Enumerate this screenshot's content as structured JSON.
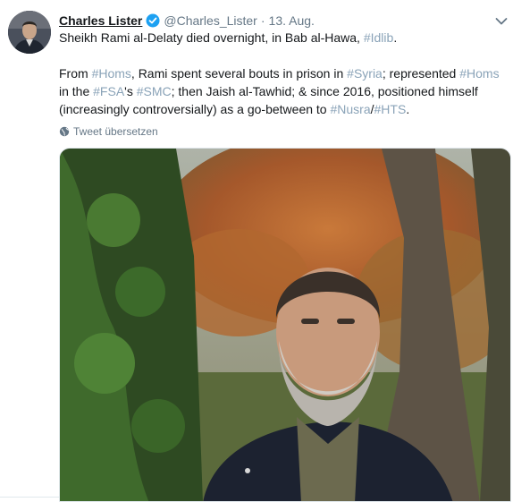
{
  "tweet": {
    "author_name": "Charles Lister",
    "handle": "@Charles_Lister",
    "separator": "·",
    "date": "13. Aug.",
    "paragraph1": [
      {
        "text": "Sheikh Rami al-Delaty died overnight, in Bab al-Hawa, ",
        "tag": false
      },
      {
        "text": "#Idlib",
        "tag": true
      },
      {
        "text": ".",
        "tag": false
      }
    ],
    "paragraph2": [
      {
        "text": "From ",
        "tag": false
      },
      {
        "text": "#Homs",
        "tag": true
      },
      {
        "text": ", Rami spent several bouts in prison in ",
        "tag": false
      },
      {
        "text": "#Syria",
        "tag": true
      },
      {
        "text": "; represented ",
        "tag": false
      },
      {
        "text": "#Homs",
        "tag": true
      },
      {
        "text": " in the ",
        "tag": false
      },
      {
        "text": "#FSA",
        "tag": true
      },
      {
        "text": "'s ",
        "tag": false
      },
      {
        "text": "#SMC",
        "tag": true
      },
      {
        "text": "; then Jaish al-Tawhid; & since 2016, positioned himself (increasingly controversially) as a go-between to ",
        "tag": false
      },
      {
        "text": "#Nusra",
        "tag": true
      },
      {
        "text": "/",
        "tag": false
      },
      {
        "text": "#HTS",
        "tag": true
      },
      {
        "text": ".",
        "tag": false
      }
    ],
    "translate_label": "Tweet übersetzen"
  },
  "icons": {
    "verified": "verified-badge-icon",
    "more": "chevron-down-icon",
    "translate": "globe-icon"
  },
  "colors": {
    "hashtag": "#8aa3b8",
    "verified": "#1da1f2",
    "secondary_text": "#657786"
  }
}
